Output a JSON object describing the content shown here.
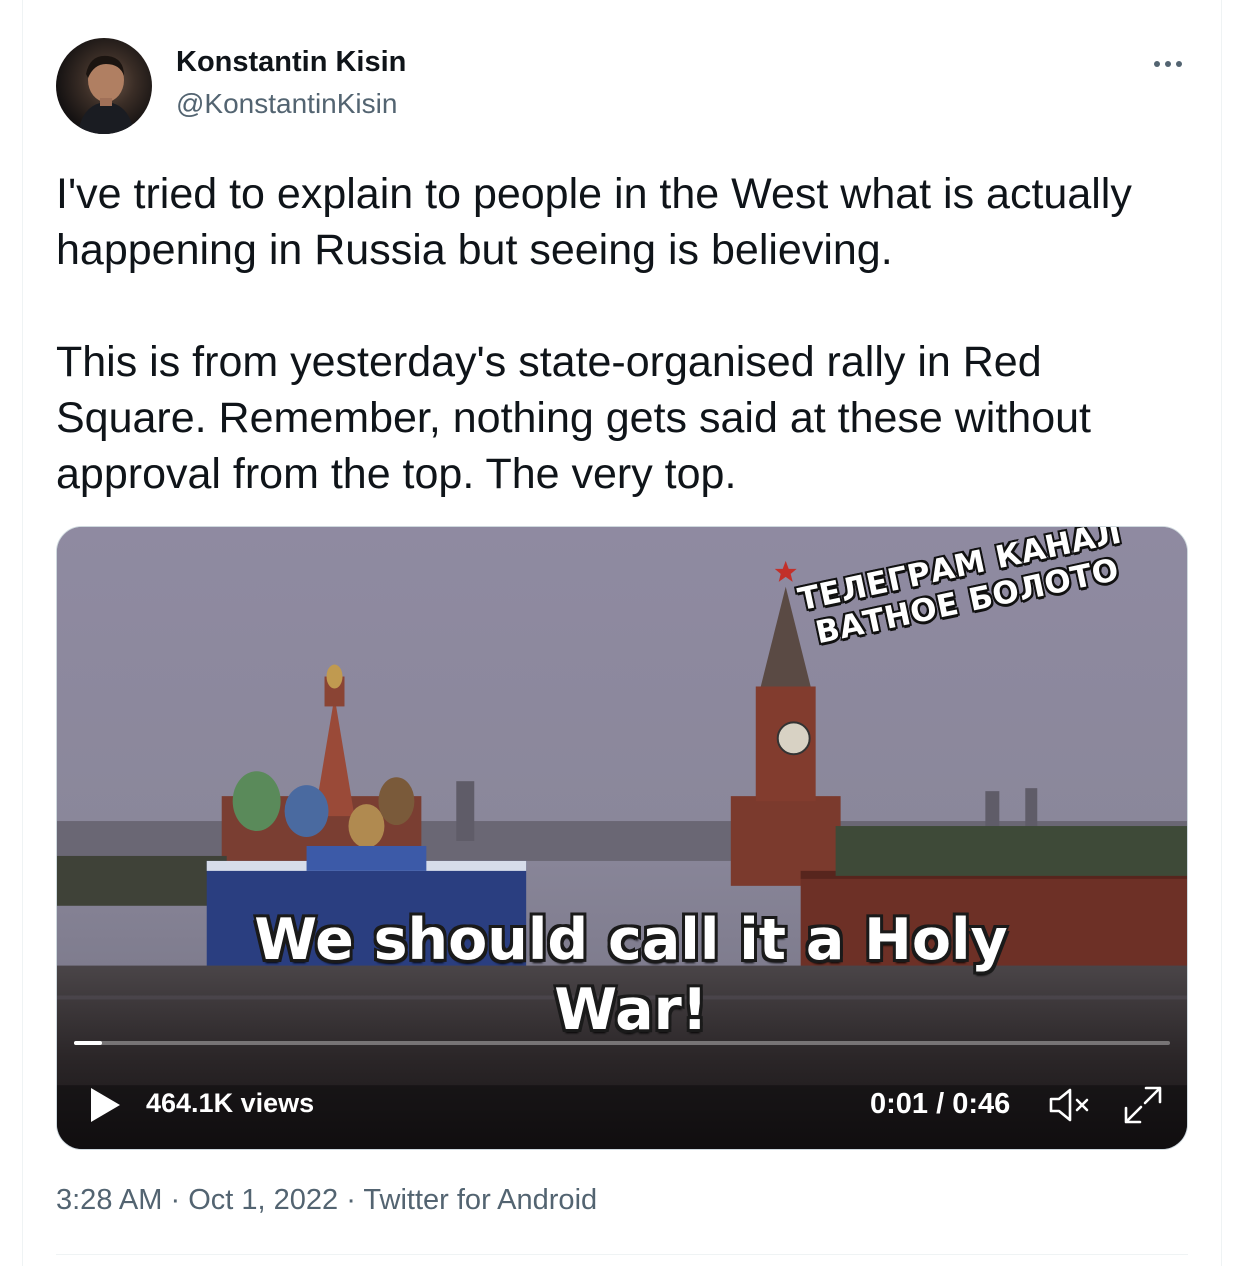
{
  "tweet": {
    "author_name": "Konstantin Kisin",
    "author_handle": "@KonstantinKisin",
    "text": "I've tried to explain to people in the West what is actually happening in Russia but seeing is believing.\n\nThis is from yesterday's state-organised rally in Red Square. Remember, nothing gets said at these without approval from the top. The very top.",
    "timestamp": "3:28 AM",
    "date": "Oct 1, 2022",
    "separator": "·",
    "source": "Twitter for Android"
  },
  "video": {
    "watermark_line1": "ТЕЛЕГРАМ КАНАЛ",
    "watermark_line2": "ВАТНОЕ БОЛОТО",
    "caption": "We should call it a Holy War!",
    "views": "464.1K views",
    "time": "0:01 / 0:46",
    "progress": 0.026,
    "muted": true
  },
  "icons": {
    "more": "more-dots-icon",
    "play": "play-icon",
    "mute": "muted-speaker-icon",
    "fullscreen": "fullscreen-icon"
  },
  "colors": {
    "text_primary": "#0f1419",
    "text_secondary": "#536471",
    "border": "#cfd9de"
  }
}
